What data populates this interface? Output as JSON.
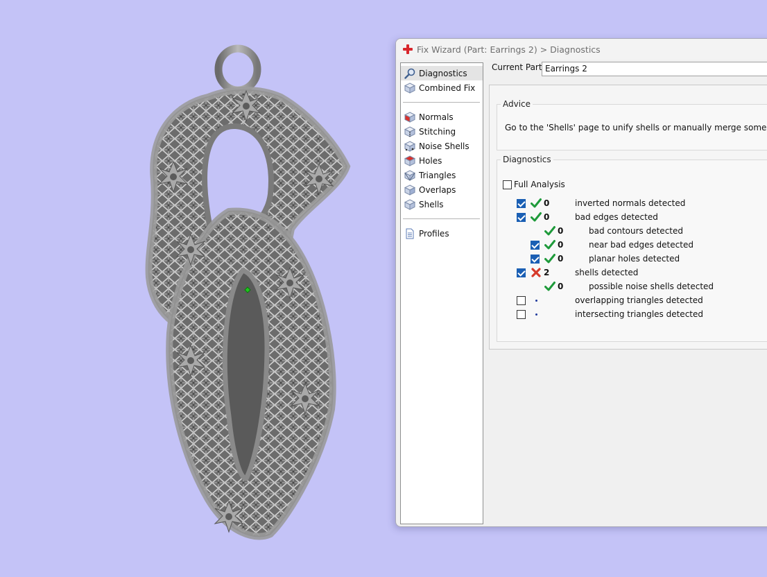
{
  "window": {
    "title": "Fix Wizard (Part: Earrings 2) > Diagnostics"
  },
  "nav": {
    "items": [
      {
        "label": "Diagnostics",
        "icon": "magnifier-icon",
        "selected": true
      },
      {
        "label": "Combined Fix",
        "icon": "cube-icon"
      },
      {
        "label": "Normals",
        "icon": "cube-red-face-icon"
      },
      {
        "label": "Stitching",
        "icon": "cube-stitch-icon"
      },
      {
        "label": "Noise Shells",
        "icon": "cube-noise-icon"
      },
      {
        "label": "Holes",
        "icon": "cube-hole-icon"
      },
      {
        "label": "Triangles",
        "icon": "cube-triangles-icon"
      },
      {
        "label": "Overlaps",
        "icon": "cube-overlap-icon"
      },
      {
        "label": "Shells",
        "icon": "cube-shells-icon"
      },
      {
        "label": "Profiles",
        "icon": "document-icon"
      }
    ]
  },
  "current_part": {
    "label": "Current Part:",
    "value": "Earrings 2"
  },
  "advice": {
    "legend": "Advice",
    "text": "Go to the 'Shells' page to unify shells or manually merge some parts."
  },
  "diagnostics": {
    "legend": "Diagnostics",
    "full_analysis_label": "Full Analysis",
    "full_analysis_checked": false,
    "rows": [
      {
        "checkbox": "checked",
        "status": "ok",
        "count": "0",
        "label": "inverted normals detected",
        "indent": 0
      },
      {
        "checkbox": "checked",
        "status": "ok",
        "count": "0",
        "label": "bad edges detected",
        "indent": 0
      },
      {
        "checkbox": "none",
        "status": "ok",
        "count": "0",
        "label": "bad contours detected",
        "indent": 1
      },
      {
        "checkbox": "checked",
        "status": "ok",
        "count": "0",
        "label": "near bad edges detected",
        "indent": 1
      },
      {
        "checkbox": "checked",
        "status": "ok",
        "count": "0",
        "label": "planar holes detected",
        "indent": 1
      },
      {
        "checkbox": "checked",
        "status": "error",
        "count": "2",
        "label": "shells detected",
        "indent": 0
      },
      {
        "checkbox": "none",
        "status": "ok",
        "count": "0",
        "label": "possible noise shells detected",
        "indent": 1
      },
      {
        "checkbox": "unchecked",
        "status": "pending",
        "count": "",
        "label": "overlapping triangles detected",
        "indent": 0
      },
      {
        "checkbox": "unchecked",
        "status": "pending",
        "count": "",
        "label": "intersecting triangles detected",
        "indent": 0
      }
    ]
  },
  "colors": {
    "background": "#c4c3f7",
    "ok": "#1e9a3a",
    "error": "#d63a2a",
    "checkbox_accent": "#1a5fb4",
    "model_metal": "#8f8f8f"
  }
}
